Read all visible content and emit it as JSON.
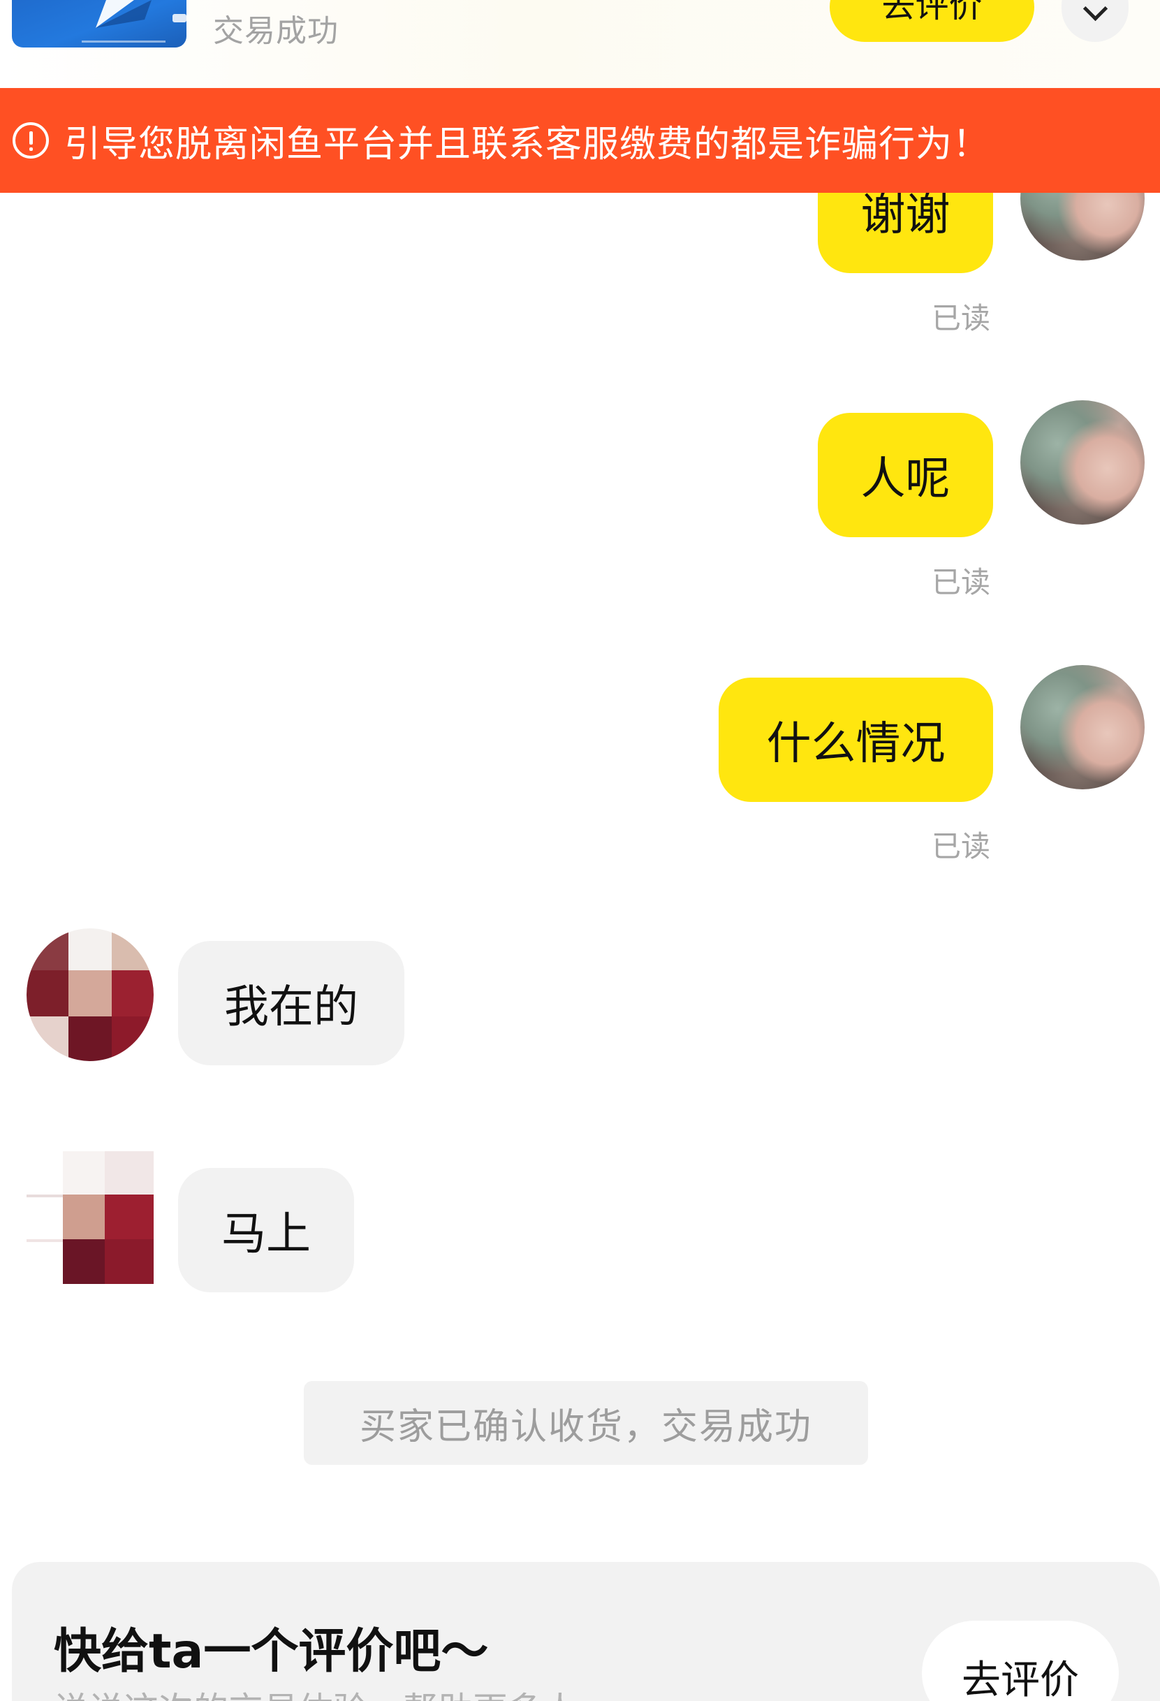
{
  "order": {
    "status": "交易成功",
    "rate_button": "去评价"
  },
  "warning": {
    "text": "引导您脱离闲鱼平台并且联系客服缴费的都是诈骗行为！"
  },
  "messages": [
    {
      "side": "right",
      "text": "谢谢",
      "read": "已读"
    },
    {
      "side": "right",
      "text": "人呢",
      "read": "已读"
    },
    {
      "side": "right",
      "text": "什么情况",
      "read": "已读"
    },
    {
      "side": "left",
      "text": "我在的"
    },
    {
      "side": "left",
      "text": "马上"
    }
  ],
  "system_notice": "买家已确认收货，交易成功",
  "review_card": {
    "title": "快给ta一个评价吧～",
    "subtitle": "说说这次的交易体验，帮助更多人",
    "button": "去评价"
  },
  "colors": {
    "accent_yellow": "#ffe60f",
    "warning_orange": "#ff5023",
    "bubble_gray": "#f2f2f2",
    "muted_text": "#a6a6a6"
  }
}
